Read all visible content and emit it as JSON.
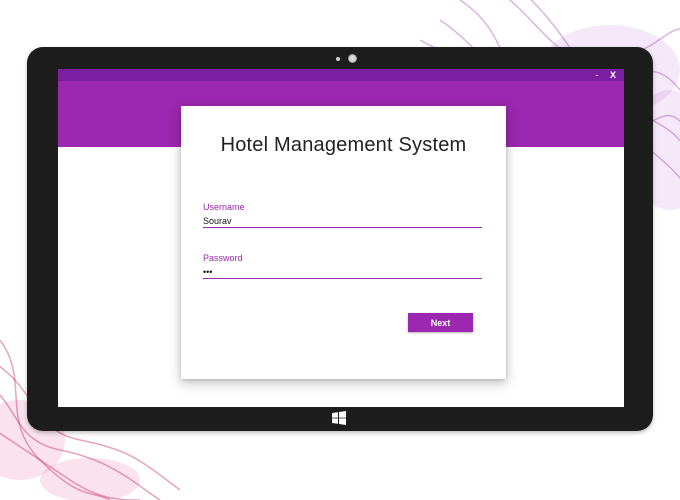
{
  "window": {
    "minimize_label": "-",
    "close_label": "X"
  },
  "login": {
    "title": "Hotel Management System",
    "username": {
      "label": "Username",
      "value": "Sourav"
    },
    "password": {
      "label": "Password",
      "value": "•••"
    },
    "next_label": "Next"
  },
  "colors": {
    "titlebar": "#7b1fa2",
    "accent": "#9c27b0",
    "device": "#1d1d1d"
  },
  "icons": [
    "windows-logo-icon",
    "camera-icon",
    "close-icon",
    "minimize-icon"
  ]
}
